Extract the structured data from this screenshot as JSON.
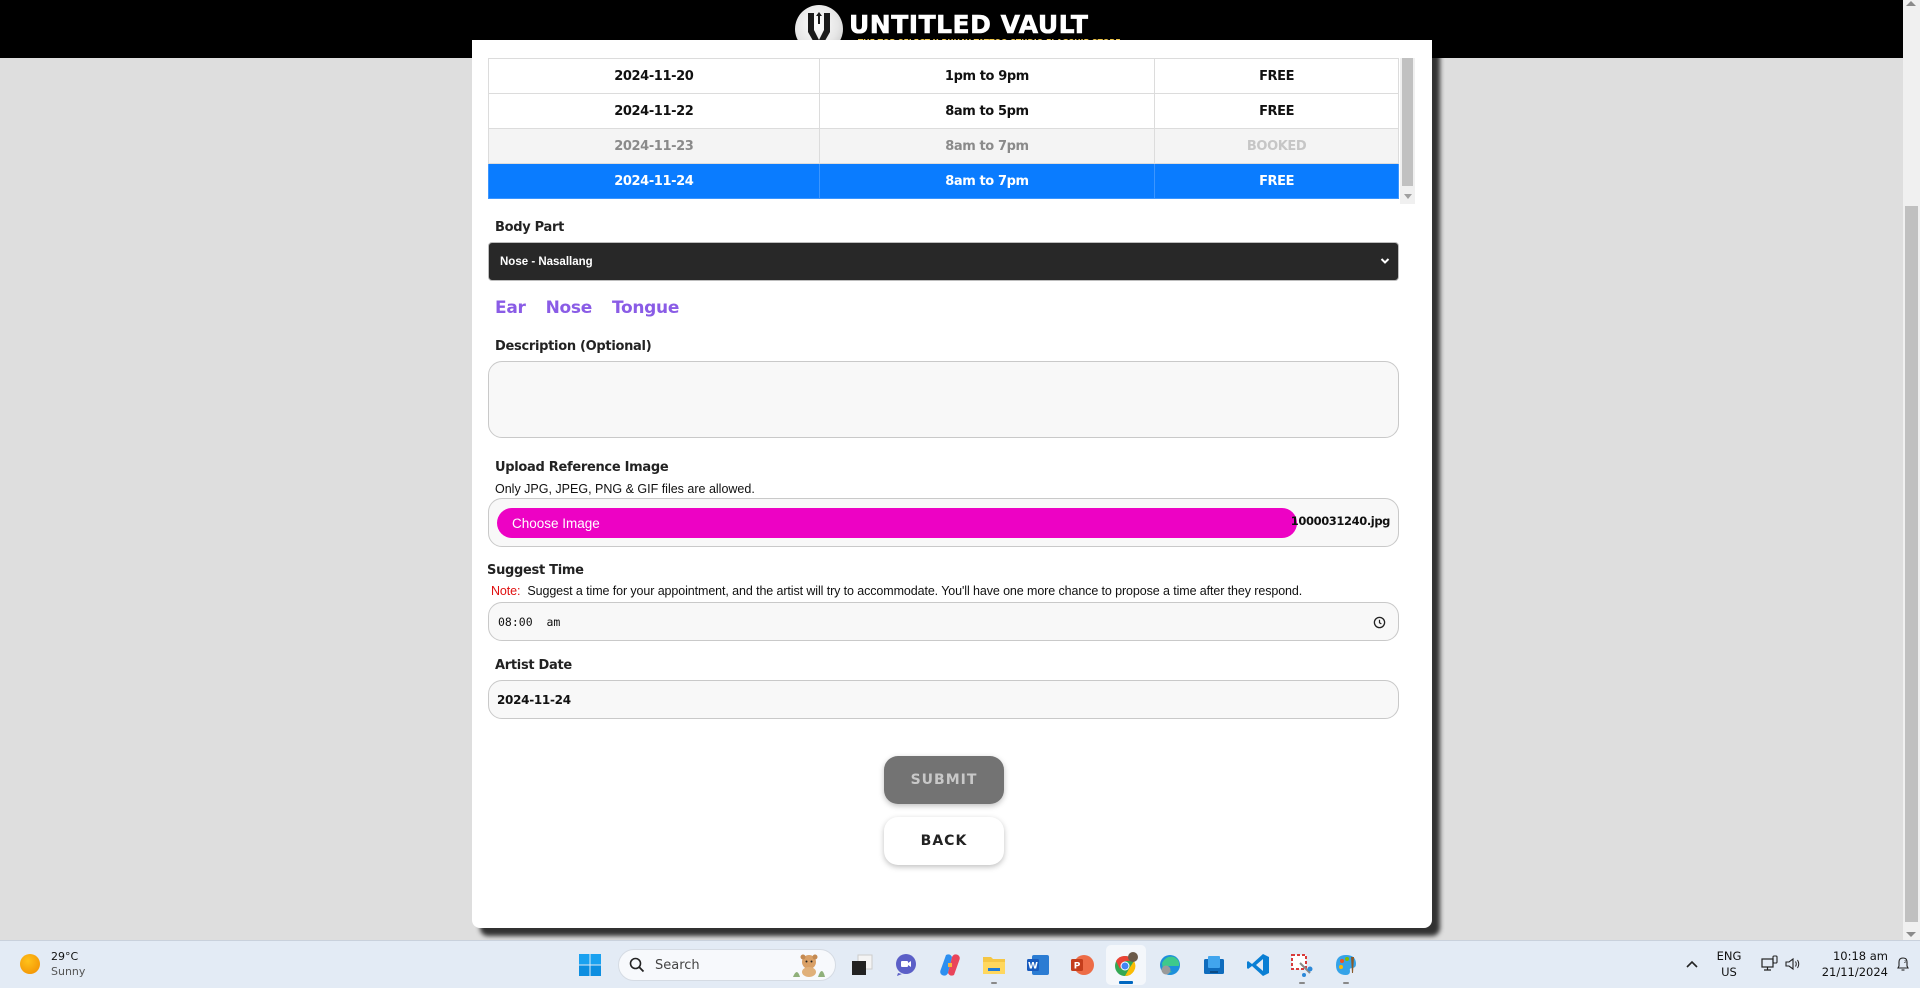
{
  "header": {
    "brand_title": "UNTITLED VAULT",
    "brand_subtitle": "THE TOP SELECT X BUHAY TATTOO STUDIO FLAGSHIP STORE",
    "logo_icon": "vault-logo-icon"
  },
  "schedule": {
    "rows": [
      {
        "date": "2024-11-20",
        "time": "1pm to 9pm",
        "status": "FREE",
        "state": "free"
      },
      {
        "date": "2024-11-22",
        "time": "8am to 5pm",
        "status": "FREE",
        "state": "free"
      },
      {
        "date": "2024-11-23",
        "time": "8am to 7pm",
        "status": "BOOKED",
        "state": "booked"
      },
      {
        "date": "2024-11-24",
        "time": "8am to 7pm",
        "status": "FREE",
        "state": "selected"
      }
    ]
  },
  "form": {
    "body_part": {
      "label": "Body Part",
      "selected": "Nose - Nasallang"
    },
    "part_links": [
      "Ear",
      "Nose",
      "Tongue"
    ],
    "description": {
      "label": "Description (Optional)",
      "value": ""
    },
    "upload": {
      "label": "Upload Reference Image",
      "help": "Only JPG, JPEG, PNG & GIF files are allowed.",
      "button_label": "Choose Image",
      "file_name": "1000031240.jpg"
    },
    "suggest_time": {
      "label": "Suggest Time",
      "note_tag": "Note:",
      "note_text": "Suggest a time for your appointment, and the artist will try to accommodate. You'll have one more chance to propose a time after they respond.",
      "value": "08:00  am"
    },
    "artist_date": {
      "label": "Artist Date",
      "value": "2024-11-24"
    },
    "submit_label": "SUBMIT",
    "back_label": "BACK"
  },
  "colors": {
    "selected_row": "#0a7cff",
    "link_purple": "#8a5ce6",
    "upload_pink": "#ed02c4",
    "note_red": "#e01010",
    "submit_gray": "#737373"
  },
  "taskbar": {
    "weather_temp": "29°C",
    "weather_condition": "Sunny",
    "search_placeholder": "Search",
    "apps": [
      "start",
      "search",
      "task-view",
      "teams-meet",
      "copilot",
      "file-explorer",
      "word",
      "powerpoint",
      "chrome",
      "edge",
      "store",
      "vscode",
      "snipping-tool",
      "paint"
    ],
    "language_top": "ENG",
    "language_bottom": "US",
    "time": "10:18 am",
    "date": "21/11/2024"
  }
}
